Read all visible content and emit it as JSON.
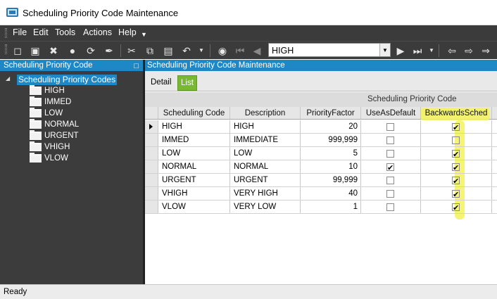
{
  "window": {
    "title": "Scheduling Priority Code Maintenance"
  },
  "menu": {
    "items": [
      {
        "label": "File",
        "name": "menu-file"
      },
      {
        "label": "Edit",
        "name": "menu-edit"
      },
      {
        "label": "Tools",
        "name": "menu-tools"
      },
      {
        "label": "Actions",
        "name": "menu-actions"
      },
      {
        "label": "Help",
        "name": "menu-help"
      }
    ]
  },
  "toolbar": {
    "icons": [
      "new-icon",
      "save-icon",
      "delete-icon",
      "comment-icon",
      "refresh-icon",
      "clear-icon",
      "cut-icon",
      "copy-icon",
      "paste-icon",
      "undo-icon",
      "search-icon",
      "first-record-icon",
      "previous-record-icon",
      "next-record-icon",
      "last-record-icon",
      "back-icon",
      "forward-icon",
      "more-icon"
    ],
    "record_value": "HIGH"
  },
  "tree": {
    "header": "Scheduling Priority Code",
    "root_label": "Scheduling Priority Codes",
    "children": [
      "HIGH",
      "IMMED",
      "LOW",
      "NORMAL",
      "URGENT",
      "VHIGH",
      "VLOW"
    ]
  },
  "main": {
    "header": "Scheduling Priority Code Maintenance",
    "tabs": [
      {
        "label": "Detail",
        "active": false
      },
      {
        "label": "List",
        "active": true
      }
    ],
    "group_title": "Scheduling Priority Code",
    "columns": [
      "Scheduling Code",
      "Description",
      "PriorityFactor",
      "UseAsDefault",
      "BackwardsSched"
    ],
    "rows": [
      {
        "code": "HIGH",
        "description": "HIGH",
        "factor": "20",
        "use_default": false,
        "backwards": true,
        "current": true
      },
      {
        "code": "IMMED",
        "description": "IMMEDIATE",
        "factor": "999,999",
        "use_default": false,
        "backwards": false,
        "current": false
      },
      {
        "code": "LOW",
        "description": "LOW",
        "factor": "5",
        "use_default": false,
        "backwards": true,
        "current": false
      },
      {
        "code": "NORMAL",
        "description": "NORMAL",
        "factor": "10",
        "use_default": true,
        "backwards": true,
        "current": false
      },
      {
        "code": "URGENT",
        "description": "URGENT",
        "factor": "99,999",
        "use_default": false,
        "backwards": true,
        "current": false
      },
      {
        "code": "VHIGH",
        "description": "VERY HIGH",
        "factor": "40",
        "use_default": false,
        "backwards": true,
        "current": false
      },
      {
        "code": "VLOW",
        "description": "VERY LOW",
        "factor": "1",
        "use_default": false,
        "backwards": true,
        "current": false
      }
    ],
    "highlight_color": "#f3f25b"
  },
  "status": {
    "text": "Ready"
  }
}
